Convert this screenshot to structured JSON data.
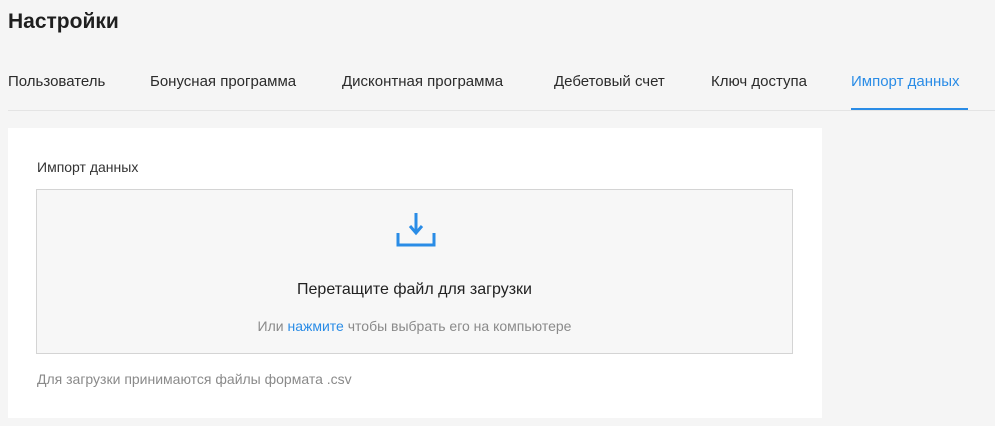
{
  "page": {
    "title": "Настройки"
  },
  "tabs": [
    {
      "label": "Пользователь",
      "active": false
    },
    {
      "label": "Бонусная программа",
      "active": false
    },
    {
      "label": "Дисконтная программа",
      "active": false
    },
    {
      "label": "Дебетовый счет",
      "active": false
    },
    {
      "label": "Ключ доступа",
      "active": false
    },
    {
      "label": "Импорт данных",
      "active": true
    }
  ],
  "import": {
    "section_title": "Импорт данных",
    "dropzone_icon": "download-icon",
    "dropzone_title": "Перетащите файл для загрузки",
    "hint_before": "Или",
    "hint_link": "нажмите",
    "hint_after": "чтобы выбрать его на компьютере",
    "footnote": "Для загрузки принимаются файлы формата .csv"
  },
  "colors": {
    "accent": "#2a8ce6",
    "background": "#f5f5f5",
    "card": "#ffffff",
    "muted_text": "#8a8a8a"
  }
}
